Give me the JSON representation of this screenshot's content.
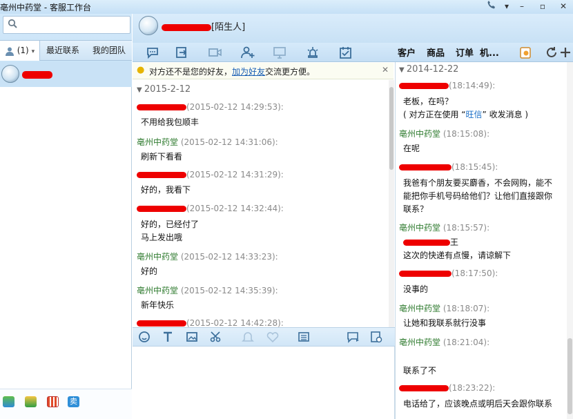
{
  "window": {
    "title": "亳州中药堂 - 客服工作台",
    "controls": [
      "phone-icon",
      "dropdown-icon",
      "minimize-icon",
      "maximize-icon",
      "close-icon"
    ]
  },
  "sidebar": {
    "search_placeholder": "",
    "tabs": [
      {
        "label": "(1)",
        "icon": "person-icon"
      },
      {
        "label": "最近联系"
      },
      {
        "label": "我的团队"
      }
    ],
    "contacts": [
      {
        "name": "[redacted]"
      }
    ],
    "bottom_apps": [
      "app-store-icon",
      "plugin-icon",
      "shop-icon",
      "sell-icon"
    ]
  },
  "header": {
    "peer_name": "[redacted]",
    "peer_tag": "[陌生人]"
  },
  "toolbar": {
    "tools": [
      "reply-icon",
      "transfer-icon",
      "video-icon",
      "add-user-icon",
      "screen-share-icon",
      "alarm-icon",
      "schedule-icon"
    ],
    "right_tabs": [
      "客户",
      "商品",
      "订单",
      "机..."
    ],
    "extra_icons": [
      "note-icon",
      "refresh-icon",
      "add-icon"
    ]
  },
  "notice": {
    "text_before": "对方还不是您的好友，",
    "link": "加为好友",
    "text_after": "交流更方便。"
  },
  "chat": {
    "date": "2015-2-12",
    "messages": [
      {
        "sender": "[redacted]",
        "time": "(2015-02-12 14:29:53):",
        "lines": [
          "不用给我包顺丰"
        ]
      },
      {
        "sender": "亳州中药堂",
        "time": "(2015-02-12 14:31:06):",
        "lines": [
          "刷新下看看"
        ]
      },
      {
        "sender": "[redacted]",
        "time": "(2015-02-12 14:31:29):",
        "lines": [
          "好的，我看下"
        ]
      },
      {
        "sender": "[redacted]",
        "time": "(2015-02-12 14:32:44):",
        "lines": [
          "好的，已经付了",
          "马上发出哦"
        ]
      },
      {
        "sender": "亳州中药堂",
        "time": "(2015-02-12 14:33:23):",
        "lines": [
          "好的"
        ]
      },
      {
        "sender": "亳州中药堂",
        "time": "(2015-02-12 14:35:39):",
        "lines": [
          "新年快乐"
        ]
      },
      {
        "sender": "[redacted]",
        "time": "(2015-02-12 14:42:28):",
        "lines": []
      }
    ]
  },
  "input_toolbar": [
    "emoji-icon",
    "font-icon",
    "image-icon",
    "scissors-icon",
    "bell-icon",
    "heart-icon",
    "keyboard-icon",
    "quick-reply-icon",
    "history-icon"
  ],
  "history": {
    "date": "2014-12-22",
    "messages": [
      {
        "sender": "[redacted]",
        "time": "(18:14:49):",
        "lines": [
          "老板，在吗？"
        ],
        "note_before": "( 对方正在使用 “",
        "note_link": "旺信",
        "note_after": "” 收发消息 )"
      },
      {
        "sender": "亳州中药堂",
        "time": "(18:15:08):",
        "lines": [
          "在呢"
        ]
      },
      {
        "sender": "[redacted]",
        "time": "(18:15:45):",
        "lines": [
          "我爸有个朋友要买麝香，不会网购，能不",
          "能把你手机号码给他们？让他们直接跟你",
          "联系？"
        ]
      },
      {
        "sender": "亳州中药堂",
        "time": "(18:15:57):",
        "lines": [
          "王",
          "这次的快递有点慢，请谅解下"
        ]
      },
      {
        "sender": "[redacted]",
        "time": "(18:17:50):",
        "lines": [
          "没事的"
        ]
      },
      {
        "sender": "亳州中药堂",
        "time": "(18:18:07):",
        "lines": [
          "让她和我联系就行没事"
        ]
      },
      {
        "sender": "亳州中药堂",
        "time": "(18:21:04):",
        "lines": [
          "",
          "联系了不"
        ]
      },
      {
        "sender": "[redacted]",
        "time": "(18:23:22):",
        "lines": [
          "电话给了，应该晚点或明后天会跟你联系"
        ]
      }
    ]
  },
  "colors": {
    "title_bar": "#c5e0f6",
    "selected_contact": "#c9e2f6",
    "sender_green": "#2d7a2d",
    "link_blue": "#1a6fc7",
    "redaction": "#ee0000"
  }
}
